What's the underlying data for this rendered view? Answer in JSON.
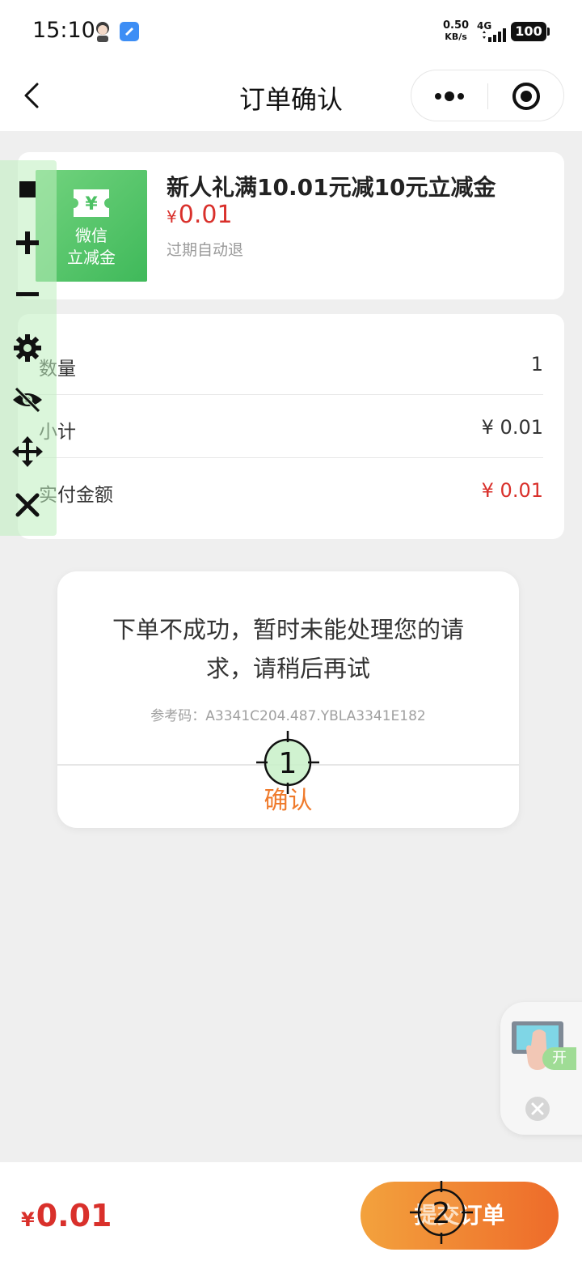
{
  "status_bar": {
    "time": "15:10",
    "net_speed_value": "0.50",
    "net_speed_unit": "KB/s",
    "network_type": "4G",
    "battery": "100"
  },
  "nav": {
    "title": "订单确认"
  },
  "product": {
    "coupon_line1": "微信",
    "coupon_line2": "立减金",
    "coupon_symbol": "¥",
    "title": "新人礼满10.01元减10元立减金",
    "currency": "¥",
    "price": "0.01",
    "note": "过期自动退"
  },
  "details": {
    "quantity_label": "数量",
    "quantity_value": "1",
    "subtotal_label": "小计",
    "subtotal_value": "¥ 0.01",
    "paid_label": "实付金额",
    "paid_value": "¥ 0.01"
  },
  "modal": {
    "message": "下单不成功，暂时未能处理您的请求，请稍后再试",
    "reference": "参考码：A3341C204.487.YBLA3341E182",
    "confirm_label": "确认"
  },
  "markers": {
    "marker1": "1",
    "marker2": "2"
  },
  "widget": {
    "open_label": "开"
  },
  "bottom": {
    "currency": "¥",
    "total": "0.01",
    "submit_label": "提交订单"
  },
  "colors": {
    "price_red": "#d9302b",
    "accent_orange": "#ef7a2b",
    "coupon_green": "#4cc163"
  }
}
